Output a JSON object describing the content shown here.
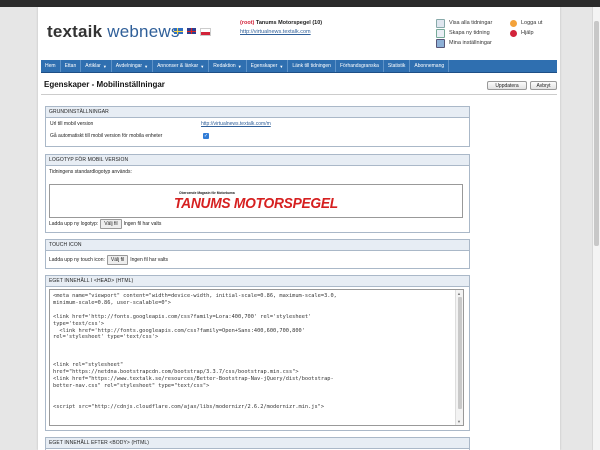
{
  "header": {
    "logo_brand": "textaik",
    "logo_product": "webnews",
    "role": "(root)",
    "paper_name": "Tanums Motorspegel (10)",
    "paper_url": "http://virtualnews.textalk.com",
    "actions": {
      "all_papers": "Visa alla tidningar",
      "new_paper": "Skapa ny tidning",
      "my_settings": "Mina inställningar",
      "logout": "Logga ut",
      "help": "Hjälp"
    }
  },
  "nav": {
    "items": [
      {
        "label": "Hem",
        "caret": false
      },
      {
        "label": "Ettan",
        "caret": false
      },
      {
        "label": "Artiklar",
        "caret": true
      },
      {
        "label": "Avdelningar",
        "caret": true
      },
      {
        "label": "Annonser & länkar",
        "caret": true
      },
      {
        "label": "Redaktion",
        "caret": true
      },
      {
        "label": "Egenskaper",
        "caret": true
      },
      {
        "label": "Länk till tidningen",
        "caret": false
      },
      {
        "label": "Förhandsgranska",
        "caret": false
      },
      {
        "label": "Statistik",
        "caret": false
      },
      {
        "label": "Abonnemang",
        "caret": false
      }
    ]
  },
  "page": {
    "title": "Egenskaper - Mobilinställningar",
    "update_label": "Uppdatera",
    "cancel_label": "Avbryt"
  },
  "basic": {
    "heading": "GRUNDINSTÄLLNINGAR",
    "url_label": "Url till mobil version",
    "url_value": "http://virtualnews.textalk.com/m",
    "auto_label": "Gå automatiskt till mobil version för mobila enheter",
    "auto_checked": true
  },
  "logo_section": {
    "heading": "LOGOTYP FÖR MOBIL VERSION",
    "default_note": "Tidningens standardlogotyp används:",
    "logo_tagline": "Oberoende Magasin för Motorbuma",
    "logo_title": "TANUMS MOTORSPEGEL",
    "upload_label": "Ladda upp ny logotyp:",
    "choose_file": "Välj fil",
    "no_file": "Ingen fil har valts"
  },
  "touch_section": {
    "heading": "TOUCH ICON",
    "upload_label": "Ladda upp ny touch icon:",
    "choose_file": "Välj fil",
    "no_file": "Ingen fil har valts"
  },
  "head_section": {
    "heading": "EGET INNEHÅLL I <HEAD> (HTML)",
    "code": "<meta name=\"viewport\" content=\"width=device-width, initial-scale=0.86, maximum-scale=3.0,\nminimum-scale=0.86, user-scalable=0\">\n\n<link href='http://fonts.googleapis.com/css?family=Lora:400,700' rel='stylesheet'\ntype='text/css'>\n  <link href='http://fonts.googleapis.com/css?family=Open+Sans:400,600,700,800'\nrel='stylesheet' type='text/css'>\n\n\n\n<link rel=\"stylesheet\"\nhref=\"https://netdna.bootstrapcdn.com/bootstrap/3.3.7/css/bootstrap.min.css\">\n<link href=\"https://www.textalk.se/resources/Better-Bootstrap-Nav-jQuery/dist/bootstrap-\nbetter-nav.css\" rel=\"stylesheet\" type=\"text/css\">\n\n\n<script src=\"http://cdnjs.cloudflare.com/ajax/libs/modernizr/2.6.2/modernizr.min.js\">"
  },
  "body_section": {
    "heading": "EGET INNEHÅLL EFTER <BODY> (HTML)"
  }
}
